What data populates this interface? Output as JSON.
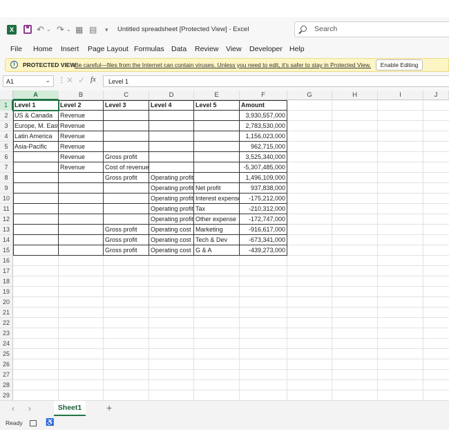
{
  "window": {
    "title": "Untitled spreadsheet  [Protected View]  -  Excel",
    "search_placeholder": "Search",
    "logo_letter": "X"
  },
  "menu": [
    "File",
    "Home",
    "Insert",
    "Page Layout",
    "Formulas",
    "Data",
    "Review",
    "View",
    "Developer",
    "Help"
  ],
  "protected_bar": {
    "title": "PROTECTED VIEW",
    "message": "Be careful—files from the Internet can contain viruses. Unless you need to edit, it's safer to stay in Protected View.",
    "button": "Enable Editing"
  },
  "formula_bar": {
    "name_box": "A1",
    "content": "Level 1"
  },
  "columns": [
    "A",
    "B",
    "C",
    "D",
    "E",
    "F",
    "G",
    "H",
    "I",
    "J"
  ],
  "rows": [
    "1",
    "2",
    "3",
    "4",
    "5",
    "6",
    "7",
    "8",
    "9",
    "10",
    "11",
    "12",
    "13",
    "14",
    "15",
    "16",
    "17",
    "18",
    "19",
    "20",
    "21",
    "22",
    "23",
    "24",
    "25",
    "26",
    "27",
    "28",
    "29"
  ],
  "table": {
    "header": [
      "Level 1",
      "Level 2",
      "Level 3",
      "Level 4",
      "Level 5",
      "Amount"
    ],
    "rows": [
      [
        "US & Canada",
        "Revenue",
        "",
        "",
        "",
        "3,930,557,000"
      ],
      [
        "Europe, M. East",
        "Revenue",
        "",
        "",
        "",
        "2,783,530,000"
      ],
      [
        "Latin America",
        "Revenue",
        "",
        "",
        "",
        "1,156,023,000"
      ],
      [
        "Asia-Pacific",
        "Revenue",
        "",
        "",
        "",
        "962,715,000"
      ],
      [
        "",
        "Revenue",
        "Gross profit",
        "",
        "",
        "3,525,340,000"
      ],
      [
        "",
        "Revenue",
        "Cost of revenue",
        "",
        "",
        "-5,307,485,000"
      ],
      [
        "",
        "",
        "Gross profit",
        "Operating profit",
        "",
        "1,496,109,000"
      ],
      [
        "",
        "",
        "",
        "Operating profit",
        "Net profit",
        "937,838,000"
      ],
      [
        "",
        "",
        "",
        "Operating profit",
        "Interest expense",
        "-175,212,000"
      ],
      [
        "",
        "",
        "",
        "Operating profit",
        "Tax",
        "-210,312,000"
      ],
      [
        "",
        "",
        "",
        "Operating profit",
        "Other expense",
        "-172,747,000"
      ],
      [
        "",
        "",
        "Gross profit",
        "Operating cost",
        "Marketing",
        "-916,617,000"
      ],
      [
        "",
        "",
        "Gross profit",
        "Operating cost",
        "Tech & Dev",
        "-673,341,000"
      ],
      [
        "",
        "",
        "Gross profit",
        "Operating cost",
        "G & A",
        "-439,273,000"
      ]
    ]
  },
  "sheet_tabs": [
    "Sheet1"
  ],
  "status": {
    "text": "Ready"
  },
  "colors": {
    "excel_green": "#217346",
    "protected_bg": "#fdf5c4"
  }
}
